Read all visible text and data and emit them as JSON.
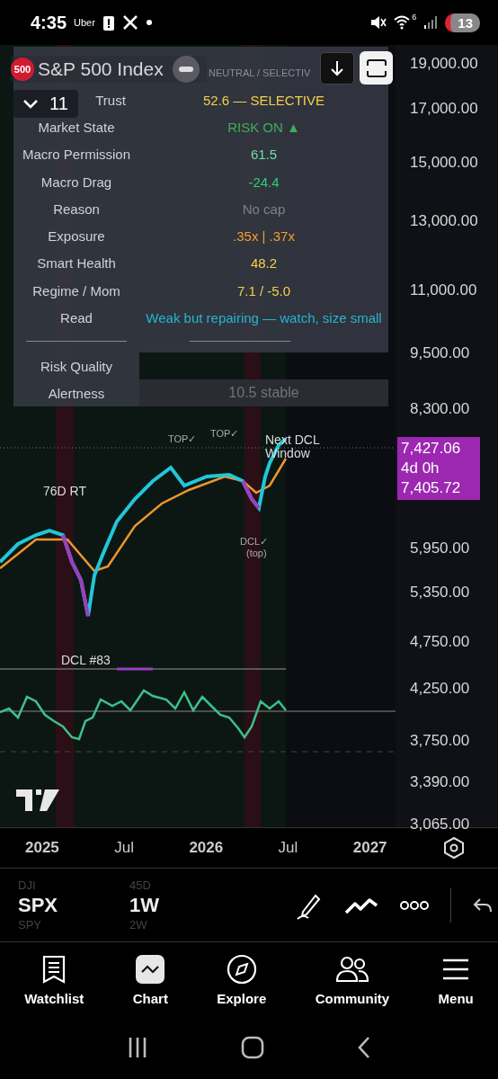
{
  "status_bar": {
    "time": "4:35",
    "app_label": "Uber",
    "network": "6",
    "battery": "13"
  },
  "header": {
    "logo": "500",
    "title": "S&P 500 Index",
    "interval_count": "11"
  },
  "table": {
    "header_value": "NEUTRAL / SELECTIV",
    "rows": [
      {
        "label": "Trust",
        "value": "52.6  —  SELECTIVE",
        "color": "#f2d04b"
      },
      {
        "label": "Market State",
        "value": "RISK ON ▲",
        "color": "#3fae5a"
      },
      {
        "label": "Macro Permission",
        "value": "61.5",
        "color": "#6ee0a8"
      },
      {
        "label": "Macro Drag",
        "value": "-24.4",
        "color": "#2ed07a"
      },
      {
        "label": "Reason",
        "value": "No cap",
        "color": "#7d8189"
      },
      {
        "label": "Exposure",
        "value": ".35x  |  .37x",
        "color": "#f0a030"
      },
      {
        "label": "Smart Health",
        "value": "48.2",
        "color": "#f2d04b"
      },
      {
        "label": "Regime / Mom",
        "value": "7.1  /  -5.0",
        "color": "#f2d04b"
      },
      {
        "label": "Read",
        "value": "Weak but repairing — watch, size small",
        "color": "#27b5cf"
      }
    ],
    "lower_rows": [
      {
        "label": "Risk Quality",
        "value": null
      },
      {
        "label": "Alertness",
        "value": "10.5  stable",
        "color": "#70737a"
      }
    ]
  },
  "chart": {
    "annotations": [
      {
        "kind": "mark",
        "text": "TOP✓"
      },
      {
        "kind": "mark",
        "text": "TOP✓"
      },
      {
        "kind": "label",
        "text": "Next DCL Window"
      },
      {
        "kind": "label",
        "text": "76D RT"
      },
      {
        "kind": "mark",
        "text": "DCL✓"
      },
      {
        "kind": "mark",
        "text": "(top)"
      },
      {
        "kind": "label",
        "text": "DCL #83"
      }
    ],
    "price_tags": [
      "7,427.06",
      "4d 0h",
      "7,405.72"
    ],
    "y_axis": [
      "19,000.00",
      "17,000.00",
      "15,000.00",
      "13,000.00",
      "11,000.00",
      "9,500.00",
      "8,300.00",
      "5,950.00",
      "5,350.00",
      "4,750.00",
      "4,250.00",
      "3,750.00",
      "3,390.00",
      "3,065.00"
    ],
    "x_axis": [
      {
        "text": "2025",
        "bold": true
      },
      {
        "text": "Jul",
        "bold": false
      },
      {
        "text": "2026",
        "bold": true
      },
      {
        "text": "Jul",
        "bold": false
      },
      {
        "text": "2027",
        "bold": true
      }
    ]
  },
  "picker": {
    "symbols": [
      {
        "text": "DJI",
        "selected": false
      },
      {
        "text": "SPX",
        "selected": true
      },
      {
        "text": "SPY",
        "selected": false
      }
    ],
    "intervals": [
      {
        "text": "45D",
        "selected": false
      },
      {
        "text": "1W",
        "selected": true
      },
      {
        "text": "2W",
        "selected": false
      }
    ]
  },
  "nav": [
    {
      "label": "Watchlist",
      "selected": false
    },
    {
      "label": "Chart",
      "selected": true
    },
    {
      "label": "Explore",
      "selected": false
    },
    {
      "label": "Community",
      "selected": false
    },
    {
      "label": "Menu",
      "selected": false
    }
  ]
}
